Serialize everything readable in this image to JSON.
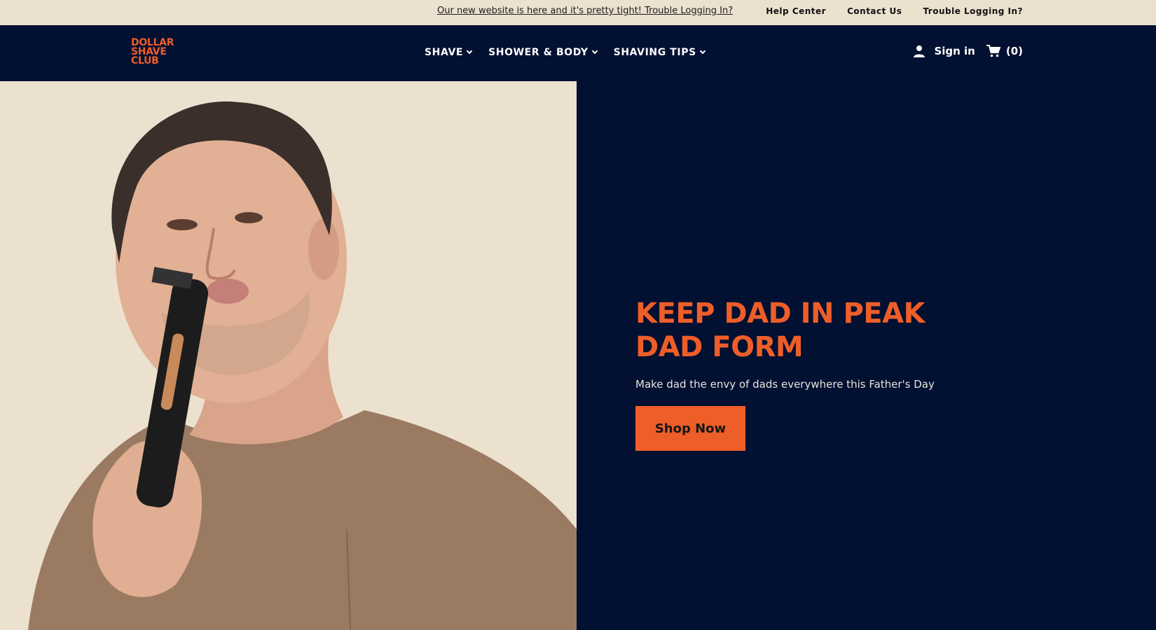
{
  "announcement": {
    "text": "Our new website is here and it's pretty tight! Trouble Logging In?"
  },
  "utility_links": [
    "Help Center",
    "Contact Us",
    "Trouble Logging In?"
  ],
  "logo": {
    "lines": [
      "DOLLAR",
      "SHAVE",
      "CLUB"
    ]
  },
  "nav": {
    "items": [
      {
        "label": "SHAVE"
      },
      {
        "label": "SHOWER & BODY"
      },
      {
        "label": "SHAVING TIPS"
      }
    ]
  },
  "account": {
    "signin_label": "Sign in",
    "cart_count": "(0)"
  },
  "hero": {
    "headline": "KEEP DAD IN PEAK DAD FORM",
    "subhead": "Make dad the envy of dads everywhere this Father's Day",
    "cta": "Shop Now"
  },
  "colors": {
    "navy": "#021031",
    "cream": "#ece1cf",
    "orange": "#ee5e29"
  },
  "icons": [
    "user-icon",
    "cart-icon",
    "chevron-down-icon"
  ]
}
